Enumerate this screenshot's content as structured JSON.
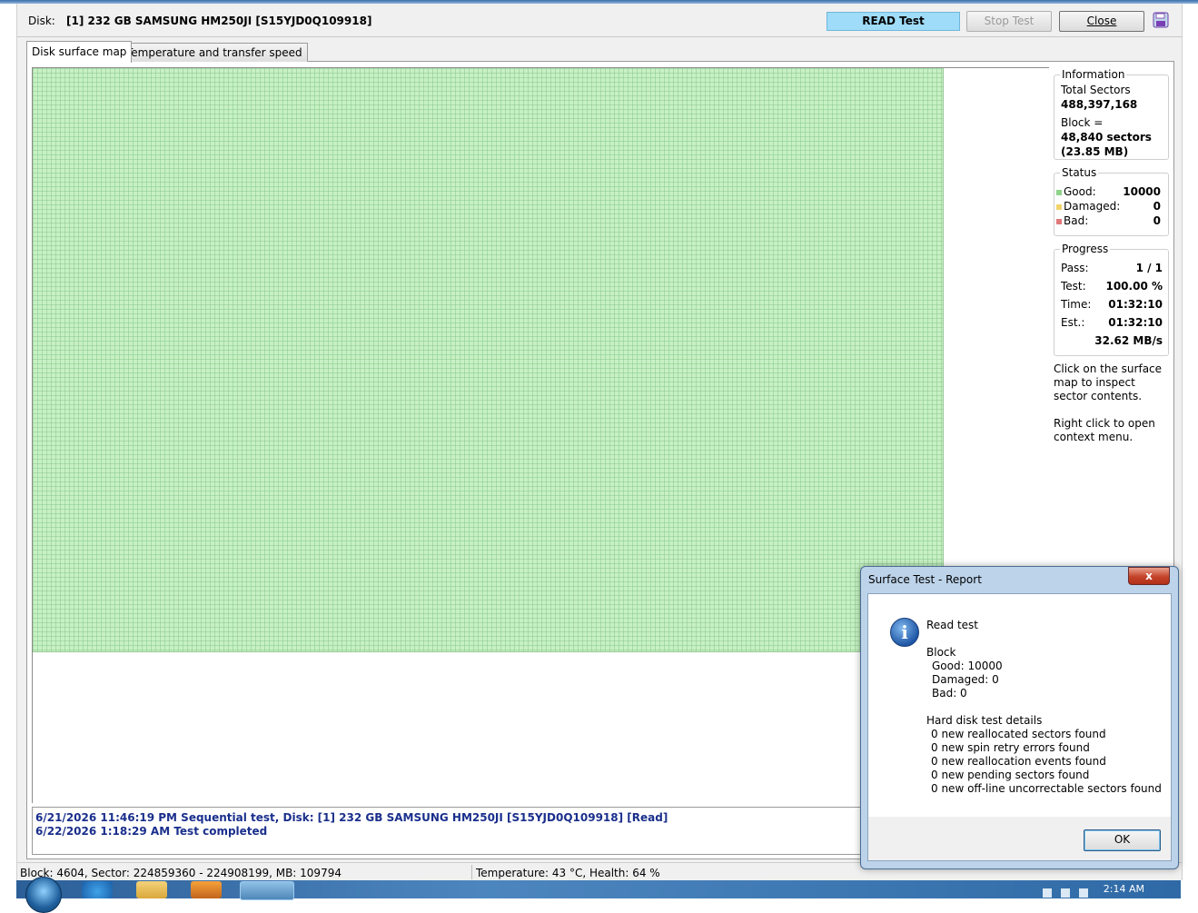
{
  "header": {
    "disk_label": "Disk:",
    "disk_value": "[1] 232 GB  SAMSUNG HM250JI [S15YJD0Q109918]",
    "read_banner": "READ Test",
    "stop_button": "Stop Test",
    "close_button": "Close",
    "save_icon": "floppy-disk-icon"
  },
  "tabs": [
    {
      "label": "Disk surface map",
      "active": true
    },
    {
      "label": "Temperature and transfer speed",
      "active": false
    }
  ],
  "surface_map": {
    "status": "Good",
    "color": "#c7f1c5"
  },
  "information": {
    "title": "Information",
    "total_sectors_label": "Total Sectors",
    "total_sectors_value": "488,397,168",
    "block_label": "Block =",
    "block_sectors": "48,840 sectors",
    "block_size": "(23.85 MB)"
  },
  "status": {
    "title": "Status",
    "good_label": "Good:",
    "good_value": "10000",
    "good_color": "#8fd38c",
    "damaged_label": "Damaged:",
    "damaged_value": "0",
    "damaged_color": "#f0d36a",
    "bad_label": "Bad:",
    "bad_value": "0",
    "bad_color": "#e0787a"
  },
  "progress": {
    "title": "Progress",
    "pass_label": "Pass:",
    "pass_value": "1 / 1",
    "test_label": "Test:",
    "test_value": "100.00 %",
    "time_label": "Time:",
    "time_value": "01:32:10",
    "est_label": "Est.:",
    "est_value": "01:32:10",
    "speed_value": "32.62 MB/s"
  },
  "hints": {
    "hint1": "Click on the surface map to inspect sector contents.",
    "hint2": "Right click to open context menu."
  },
  "log": [
    "6/21/2026  11:46:19 PM   Sequential test, Disk: [1] 232 GB  SAMSUNG HM250JI [S15YJD0Q109918] [Read]",
    "6/22/2026  1:18:29 AM   Test completed"
  ],
  "statusbar": {
    "left": "Block: 4604, Sector: 224859360 - 224908199, MB: 109794",
    "right": "Temperature: 43  °C,  Health: 64 %"
  },
  "dialog": {
    "title": "Surface Test - Report",
    "close_glyph": "x",
    "icon": "information-icon",
    "icon_glyph": "i",
    "heading": "Read test",
    "block_title": "Block",
    "good": "Good: 10000",
    "damaged": "Damaged: 0",
    "bad": "Bad: 0",
    "details_title": "Hard disk test details",
    "details": [
      "0 new reallocated sectors found",
      "0 new spin retry errors found",
      "0 new reallocation events found",
      "0 new pending sectors found",
      "0 new off-line uncorrectable sectors found"
    ],
    "ok_button": "OK"
  },
  "taskbar": {
    "clock": "2:14 AM",
    "icons": [
      "start-orb-icon",
      "internet-explorer-icon",
      "folder-icon",
      "media-player-icon",
      "hd-tune-icon"
    ]
  }
}
